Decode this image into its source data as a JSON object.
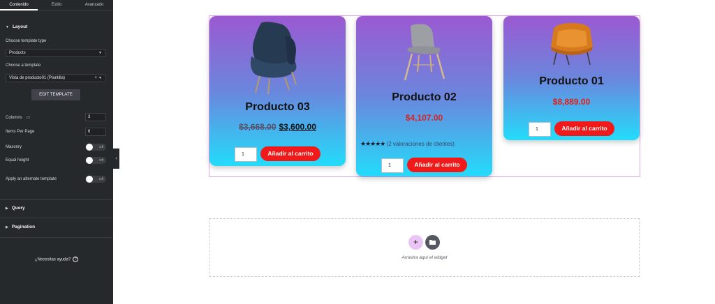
{
  "tabs": [
    {
      "label": "Contenido",
      "active": true
    },
    {
      "label": "Estilo",
      "active": false
    },
    {
      "label": "Avanzado",
      "active": false
    }
  ],
  "layout": {
    "title": "Layout",
    "template_type_label": "Choose template type",
    "template_type_value": "Products",
    "template_label": "Choose a template",
    "template_value": "Vista de producto01 (Plantilla)",
    "edit_button": "EDIT TEMPLATE",
    "columns_label": "Columns",
    "columns_value": "3",
    "items_label": "Items Per Page",
    "items_value": "6",
    "masonry_label": "Masonry",
    "equal_height_label": "Equal height",
    "alternate_label": "Apply an alternate template",
    "toggle_off": "Off"
  },
  "query_title": "Query",
  "pagination_title": "Pagination",
  "help_text": "¿Necesitas ayuda?",
  "products": [
    {
      "name": "Producto 03",
      "old_price": "$3,668.00",
      "price": "$3,600.00",
      "qty": "1",
      "cart": "Añadir al carrito",
      "image": "blue-armchair"
    },
    {
      "name": "Producto 02",
      "price": "$4,107.00",
      "rating_text": "(2 valoraciones de clientes)",
      "stars": 5,
      "qty": "1",
      "cart": "Añadir al carrito",
      "image": "grey-dining-chair"
    },
    {
      "name": "Producto 01",
      "price": "$8,889.00",
      "qty": "1",
      "cart": "Añadir al carrito",
      "image": "orange-armchair"
    }
  ],
  "dropzone": {
    "add_icon": "+",
    "text": "Arrastra aquí el widget"
  },
  "colors": {
    "panel": "#26292c",
    "card_top": "#9b59d1",
    "card_bottom": "#23dcfb",
    "cart_button": "#f01a1a",
    "price_red": "#e0201c"
  }
}
